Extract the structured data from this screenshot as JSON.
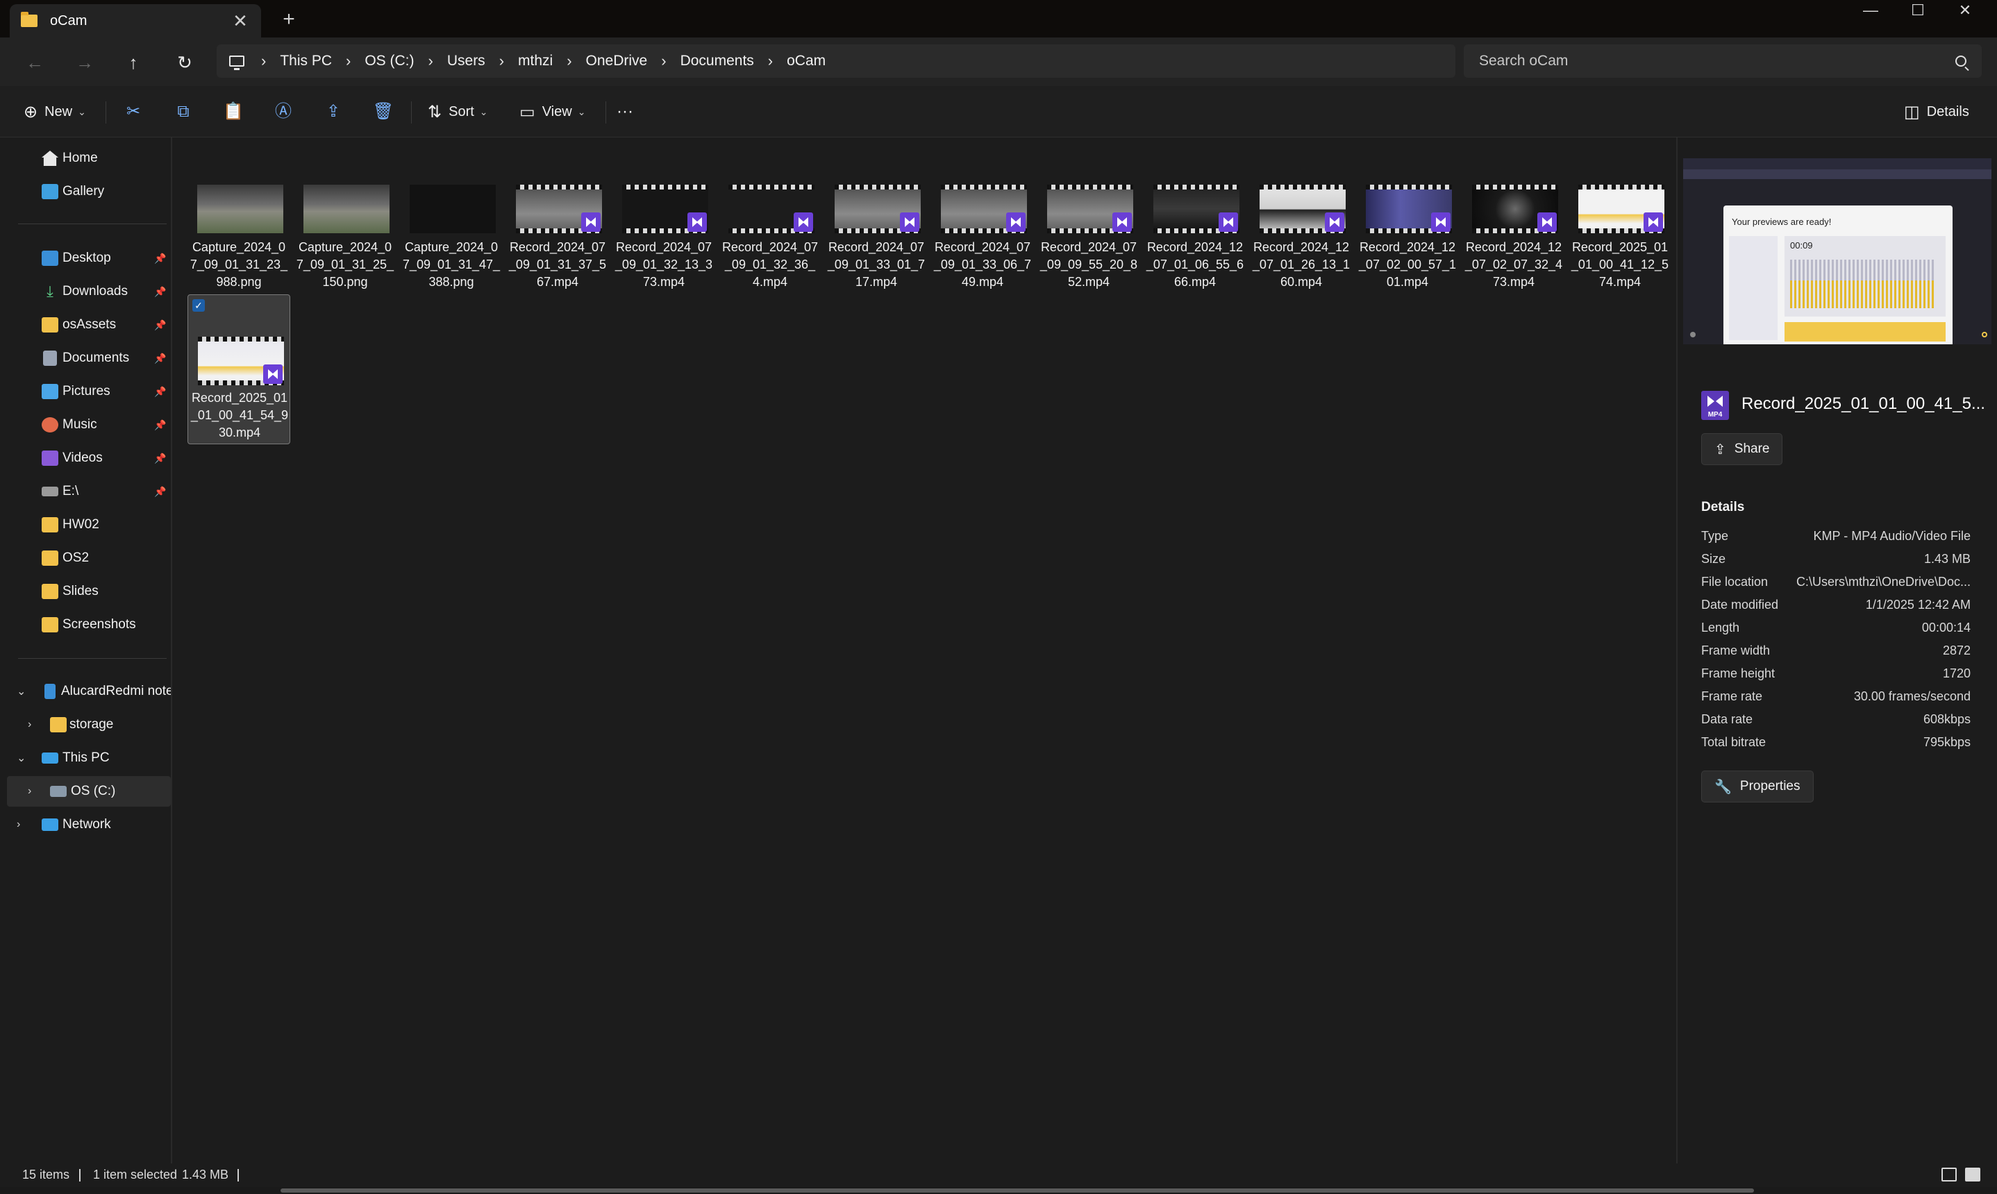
{
  "window": {
    "tab_title": "oCam",
    "new_tab": "+",
    "close_tab": "✕"
  },
  "address": {
    "breadcrumbs": [
      "This PC",
      "OS (C:)",
      "Users",
      "mthzi",
      "OneDrive",
      "Documents",
      "oCam"
    ],
    "search_placeholder": "Search oCam"
  },
  "commands": {
    "new_label": "New",
    "sort_label": "Sort",
    "view_label": "View",
    "details_label": "Details",
    "more_label": "···"
  },
  "nav": {
    "items": [
      {
        "label": "Home",
        "icon": "home-icon"
      },
      {
        "label": "Gallery",
        "icon": "gallery-icon"
      },
      {
        "label": "Desktop",
        "icon": "desktop-icon",
        "pinned": true
      },
      {
        "label": "Downloads",
        "icon": "downloads-icon",
        "pinned": true
      },
      {
        "label": "osAssets",
        "icon": "folder-icon",
        "pinned": true
      },
      {
        "label": "Documents",
        "icon": "documents-icon",
        "pinned": true
      },
      {
        "label": "Pictures",
        "icon": "pictures-icon",
        "pinned": true
      },
      {
        "label": "Music",
        "icon": "music-icon",
        "pinned": true
      },
      {
        "label": "Videos",
        "icon": "videos-icon",
        "pinned": true
      },
      {
        "label": "E:\\",
        "icon": "drive-icon",
        "pinned": true
      },
      {
        "label": "HW02",
        "icon": "folder-icon"
      },
      {
        "label": "OS2",
        "icon": "folder-icon"
      },
      {
        "label": "Slides",
        "icon": "folder-icon"
      },
      {
        "label": "Screenshots",
        "icon": "folder-icon"
      },
      {
        "label": "AlucardRedmi note",
        "icon": "phone-icon"
      },
      {
        "label": "storage",
        "icon": "folder-icon"
      },
      {
        "label": "This PC",
        "icon": "this-pc-icon"
      },
      {
        "label": "OS (C:)",
        "icon": "drive-c-icon"
      },
      {
        "label": "Network",
        "icon": "network-icon"
      }
    ]
  },
  "files": [
    {
      "name": "Capture_2024_07_09_01_31_23_988.png",
      "type": "png"
    },
    {
      "name": "Capture_2024_07_09_01_31_25_150.png",
      "type": "png"
    },
    {
      "name": "Capture_2024_07_09_01_31_47_388.png",
      "type": "png"
    },
    {
      "name": "Record_2024_07_09_01_31_37_567.mp4",
      "type": "mp4"
    },
    {
      "name": "Record_2024_07_09_01_32_13_373.mp4",
      "type": "mp4"
    },
    {
      "name": "Record_2024_07_09_01_32_36_4.mp4",
      "type": "mp4"
    },
    {
      "name": "Record_2024_07_09_01_33_01_717.mp4",
      "type": "mp4"
    },
    {
      "name": "Record_2024_07_09_01_33_06_749.mp4",
      "type": "mp4"
    },
    {
      "name": "Record_2024_07_09_09_55_20_852.mp4",
      "type": "mp4"
    },
    {
      "name": "Record_2024_12_07_01_06_55_666.mp4",
      "type": "mp4"
    },
    {
      "name": "Record_2024_12_07_01_26_13_160.mp4",
      "type": "mp4"
    },
    {
      "name": "Record_2024_12_07_02_00_57_101.mp4",
      "type": "mp4"
    },
    {
      "name": "Record_2024_12_07_02_07_32_473.mp4",
      "type": "mp4"
    },
    {
      "name": "Record_2025_01_01_00_41_12_574.mp4",
      "type": "mp4"
    },
    {
      "name": "Record_2025_01_01_00_41_54_930.mp4",
      "type": "mp4",
      "selected": true
    }
  ],
  "details": {
    "preview_title": "Your previews are ready!",
    "preview_time": "00:09",
    "file_icon_label": "MP4",
    "filename": "Record_2025_01_01_00_41_5...",
    "share_label": "Share",
    "heading": "Details",
    "rows": [
      {
        "k": "Type",
        "v": "KMP - MP4 Audio/Video File"
      },
      {
        "k": "Size",
        "v": "1.43 MB"
      },
      {
        "k": "File location",
        "v": "C:\\Users\\mthzi\\OneDrive\\Doc..."
      },
      {
        "k": "Date modified",
        "v": "1/1/2025 12:42 AM"
      },
      {
        "k": "Length",
        "v": "00:00:14"
      },
      {
        "k": "Frame width",
        "v": "2872"
      },
      {
        "k": "Frame height",
        "v": "1720"
      },
      {
        "k": "Frame rate",
        "v": "30.00 frames/second"
      },
      {
        "k": "Data rate",
        "v": "608kbps"
      },
      {
        "k": "Total bitrate",
        "v": "795kbps"
      }
    ],
    "properties_label": "Properties"
  },
  "status": {
    "item_count": "15 items",
    "selection": "1 item selected",
    "selection_size": "1.43 MB"
  },
  "colors": {
    "accent": "#1d5fa8",
    "mp4_badge": "#6a3fd6",
    "folder": "#f2c14a"
  }
}
